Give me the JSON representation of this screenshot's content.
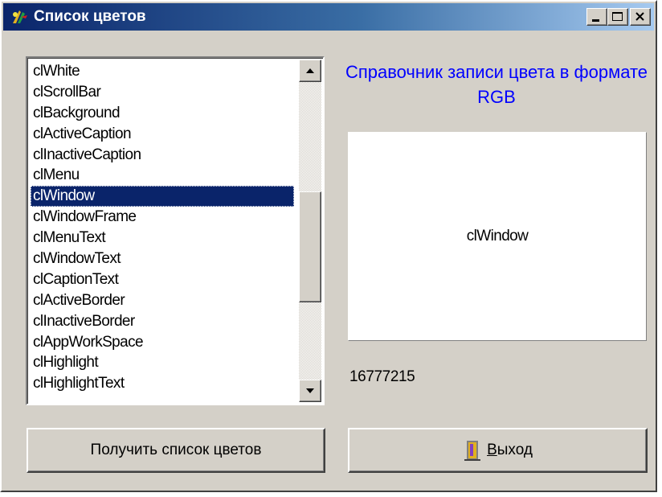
{
  "window": {
    "title": "Список цветов"
  },
  "list": {
    "items": [
      "clWhite",
      "clScrollBar",
      "clBackground",
      "clActiveCaption",
      "clInactiveCaption",
      "clMenu",
      "clWindow",
      "clWindowFrame",
      "clMenuText",
      "clWindowText",
      "clCaptionText",
      "clActiveBorder",
      "clInactiveBorder",
      "clAppWorkSpace",
      "clHighlight",
      "clHighlightText"
    ],
    "selected_index": 6
  },
  "heading": "Справочник записи цвета в формате RGB",
  "preview": {
    "color_name": "clWindow"
  },
  "rgb_value": "16777215",
  "buttons": {
    "get_colors": "Получить список цветов",
    "exit_hotkey": "В",
    "exit_rest": "ыход"
  },
  "colors": {
    "title_start": "#0a246a",
    "title_end": "#a6caf0",
    "face": "#d4d0c8",
    "selection": "#0a246a",
    "heading": "#0000ff"
  },
  "icons": {
    "app": "app-color-icon",
    "exit": "door-exit-icon"
  }
}
